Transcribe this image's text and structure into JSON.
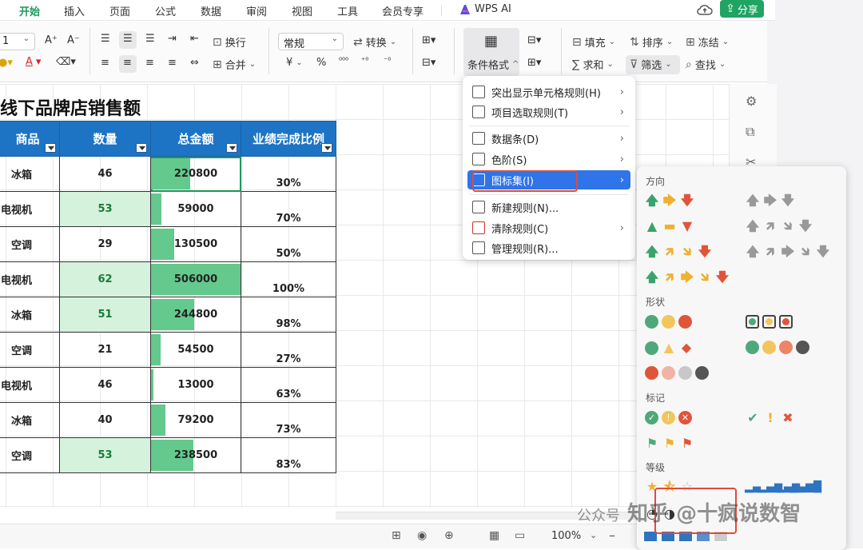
{
  "tabs": [
    "开始",
    "插入",
    "页面",
    "公式",
    "数据",
    "审阅",
    "视图",
    "工具",
    "会员专享"
  ],
  "wps_ai": "WPS AI",
  "share_label": "分享",
  "ribbon": {
    "font_size_value": "1",
    "wrap_label": "换行",
    "merge_label": "合并",
    "number_format": "常规",
    "convert_label": "转换",
    "conditional_format_label": "条件格式",
    "fill_label": "填充",
    "sort_label": "排序",
    "freeze_label": "冻结",
    "sum_label": "求和",
    "filter_label": "筛选",
    "find_label": "查找",
    "currency_symbol": "¥",
    "percent_symbol": "%"
  },
  "sheet": {
    "title": "线下品牌店销售额",
    "headers": [
      "商品",
      "数量",
      "总金额",
      "业绩完成比例"
    ],
    "rows": [
      {
        "product": "冰箱",
        "qty": "46",
        "amount": "220800",
        "amount_ratio": 0.44,
        "pct": "30%",
        "qty_green": false
      },
      {
        "product": "电视机",
        "qty": "53",
        "amount": "59000",
        "amount_ratio": 0.12,
        "pct": "70%",
        "qty_green": true
      },
      {
        "product": "空调",
        "qty": "29",
        "amount": "130500",
        "amount_ratio": 0.26,
        "pct": "50%",
        "qty_green": false
      },
      {
        "product": "电视机",
        "qty": "62",
        "amount": "506000",
        "amount_ratio": 1.0,
        "pct": "100%",
        "qty_green": true
      },
      {
        "product": "冰箱",
        "qty": "51",
        "amount": "244800",
        "amount_ratio": 0.48,
        "pct": "98%",
        "qty_green": true
      },
      {
        "product": "空调",
        "qty": "21",
        "amount": "54500",
        "amount_ratio": 0.11,
        "pct": "27%",
        "qty_green": false
      },
      {
        "product": "电视机",
        "qty": "46",
        "amount": "13000",
        "amount_ratio": 0.03,
        "pct": "63%",
        "qty_green": false
      },
      {
        "product": "冰箱",
        "qty": "40",
        "amount": "79200",
        "amount_ratio": 0.16,
        "pct": "73%",
        "qty_green": false
      },
      {
        "product": "空调",
        "qty": "53",
        "amount": "238500",
        "amount_ratio": 0.47,
        "pct": "83%",
        "qty_green": true
      }
    ]
  },
  "cf_menu": [
    {
      "label": "突出显示单元格规则(H)",
      "arrow": true
    },
    {
      "label": "项目选取规则(T)",
      "arrow": true
    },
    {
      "label": "数据条(D)",
      "arrow": true
    },
    {
      "label": "色阶(S)",
      "arrow": true
    },
    {
      "label": "图标集(I)",
      "arrow": true,
      "selected": true
    },
    {
      "label": "新建规则(N)...",
      "arrow": false
    },
    {
      "label": "清除规则(C)",
      "arrow": true
    },
    {
      "label": "管理规则(R)...",
      "arrow": false
    }
  ],
  "icon_submenu": {
    "direction": "方向",
    "shapes": "形状",
    "markers": "标记",
    "ratings": "等级"
  },
  "status": {
    "zoom": "100%"
  },
  "watermark": "知乎 @十疯说数智",
  "watermark_prefix": "公众号",
  "colors": {
    "accent_green": "#1a9a5a",
    "header_blue": "#1d74c4",
    "menu_selected": "#2f74e8",
    "highlight_red": "#e34a3a"
  }
}
